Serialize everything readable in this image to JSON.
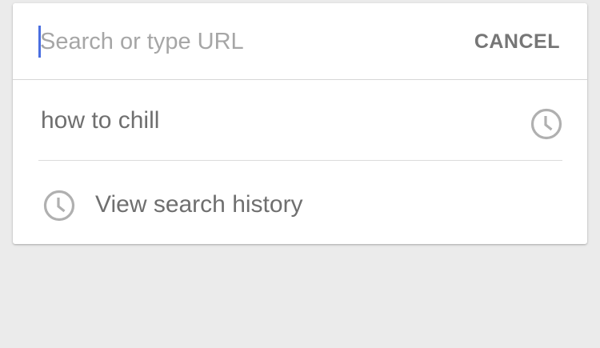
{
  "search": {
    "placeholder": "Search or type URL",
    "value": "",
    "cancel_label": "CANCEL"
  },
  "suggestions": [
    {
      "text": "how to chill",
      "icon": "clock-icon"
    }
  ],
  "history_link": {
    "label": "View search history",
    "icon": "clock-icon"
  },
  "colors": {
    "background": "#ebebeb",
    "card": "#ffffff",
    "caret": "#4a6ee0",
    "text": "#6f6f6f",
    "placeholder": "#a6a6a6",
    "icon": "#b0b0b0"
  }
}
